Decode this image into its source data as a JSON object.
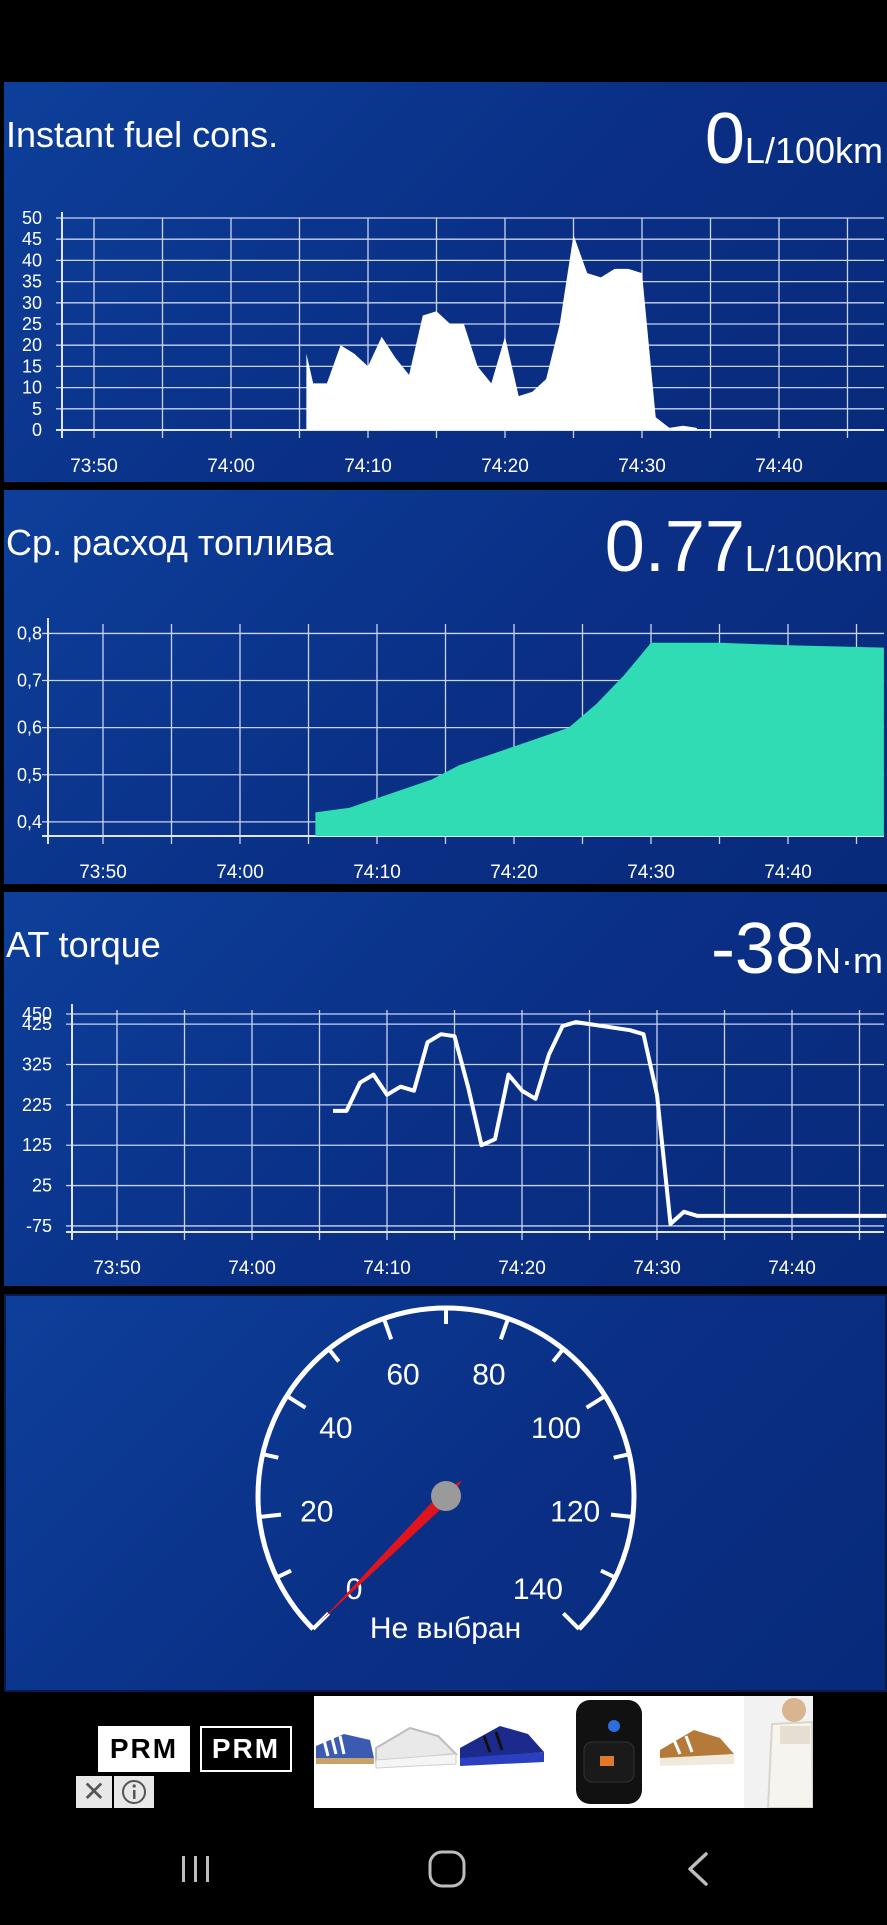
{
  "panels": {
    "instant_fuel": {
      "title": "Instant fuel cons.",
      "value": "0",
      "unit": "L/100km"
    },
    "avg_fuel": {
      "title": "Ср. расход топлива",
      "value": "0.77",
      "unit": "L/100km"
    },
    "at_torque": {
      "title": "AT torque",
      "value": "-38",
      "unit": "N·m"
    }
  },
  "gauge": {
    "label": "Не выбран",
    "ticks": [
      "0",
      "20",
      "40",
      "60",
      "80",
      "100",
      "120",
      "140"
    ],
    "min": 0,
    "max": 140,
    "value": 0
  },
  "ad": {
    "logo_text_1": "PRM",
    "logo_text_2": "PRM"
  },
  "colors": {
    "panel_bg": "#0b3590",
    "fuel_fill": "#ffffff",
    "avg_fill": "#2fdcb4",
    "needle": "#e0141e",
    "hub": "#9a9a9a"
  },
  "chart_data": [
    {
      "type": "area",
      "xtick_labels": [
        "73:50",
        "74:00",
        "74:10",
        "74:20",
        "74:30",
        "74:40"
      ],
      "ytick_labels": [
        "50",
        "45",
        "40",
        "35",
        "30",
        "25",
        "20",
        "15",
        "10",
        "5",
        "0"
      ],
      "ylim": [
        0,
        50
      ],
      "x": [
        "74:05.5",
        "74:06",
        "74:07",
        "74:08",
        "74:09",
        "74:10",
        "74:11",
        "74:12",
        "74:13",
        "74:14",
        "74:15",
        "74:16",
        "74:17",
        "74:18",
        "74:19",
        "74:20",
        "74:21",
        "74:22",
        "74:23",
        "74:24",
        "74:25",
        "74:26",
        "74:27",
        "74:28",
        "74:29",
        "74:30",
        "74:31",
        "74:32",
        "74:33",
        "74:34"
      ],
      "values": [
        18,
        11,
        11,
        20,
        18,
        15,
        22,
        17,
        13,
        27,
        28,
        25,
        25,
        15,
        11,
        22,
        8,
        9,
        12,
        25,
        46,
        37,
        36,
        38,
        38,
        37,
        3,
        0.5,
        1,
        0.5
      ]
    },
    {
      "type": "area",
      "xtick_labels": [
        "73:50",
        "74:00",
        "74:10",
        "74:20",
        "74:30",
        "74:40"
      ],
      "ytick_labels": [
        "0,8",
        "0,7",
        "0,6",
        "0,5",
        "0,4"
      ],
      "ylim": [
        0.37,
        0.82
      ],
      "x": [
        "74:05.5",
        "74:08",
        "74:10",
        "74:12",
        "74:14",
        "74:16",
        "74:18",
        "74:20",
        "74:22",
        "74:24",
        "74:26",
        "74:28",
        "74:30",
        "74:35",
        "74:40",
        "74:47"
      ],
      "values": [
        0.42,
        0.43,
        0.45,
        0.47,
        0.49,
        0.52,
        0.54,
        0.56,
        0.58,
        0.6,
        0.65,
        0.71,
        0.78,
        0.78,
        0.775,
        0.77
      ]
    },
    {
      "type": "line",
      "xtick_labels": [
        "73:50",
        "74:00",
        "74:10",
        "74:20",
        "74:30",
        "74:40"
      ],
      "ytick_labels": [
        "450",
        "425",
        "325",
        "225",
        "125",
        "25",
        "-75"
      ],
      "ylim": [
        -90,
        460
      ],
      "x": [
        "74:06",
        "74:07",
        "74:08",
        "74:09",
        "74:10",
        "74:11",
        "74:12",
        "74:13",
        "74:14",
        "74:15",
        "74:16",
        "74:17",
        "74:18",
        "74:19",
        "74:20",
        "74:21",
        "74:22",
        "74:23",
        "74:24",
        "74:25",
        "74:26",
        "74:27",
        "74:28",
        "74:29",
        "74:30",
        "74:31",
        "74:32",
        "74:33",
        "74:34",
        "74:35",
        "74:40",
        "74:47"
      ],
      "values": [
        210,
        210,
        280,
        300,
        250,
        270,
        260,
        380,
        400,
        395,
        270,
        125,
        140,
        300,
        260,
        240,
        350,
        420,
        430,
        425,
        420,
        415,
        410,
        400,
        250,
        -70,
        -40,
        -50,
        -50,
        -50,
        -50,
        -50
      ]
    }
  ]
}
